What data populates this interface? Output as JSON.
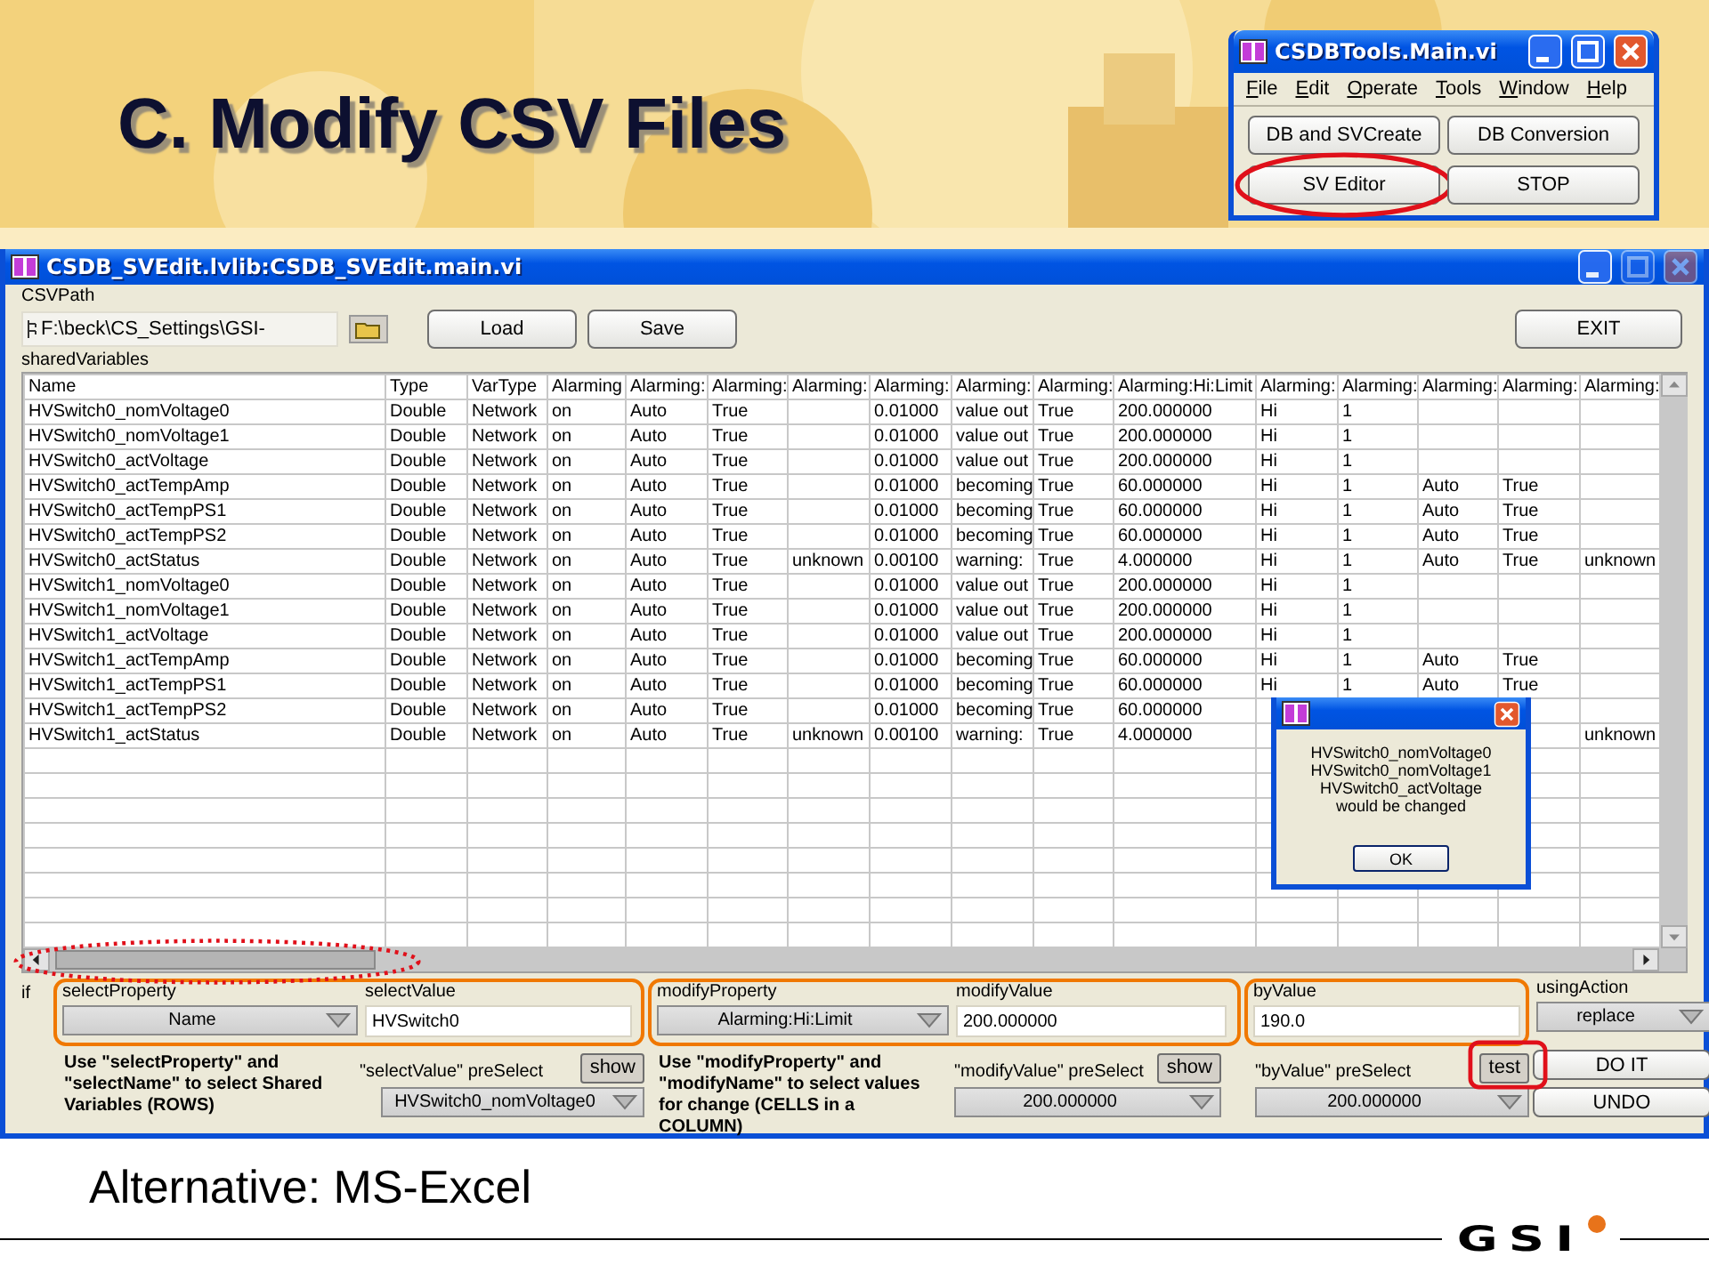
{
  "slide": {
    "title": "C. Modify CSV Files",
    "footer": "Alternative: MS-Excel",
    "logo": "GSI"
  },
  "tools_window": {
    "title": "CSDBTools.Main.vi",
    "menu": [
      "File",
      "Edit",
      "Operate",
      "Tools",
      "Window",
      "Help"
    ],
    "buttons": [
      {
        "label": "DB and SVCreate",
        "circled": false
      },
      {
        "label": "DB Conversion",
        "circled": false
      },
      {
        "label": "SV Editor",
        "circled": true
      },
      {
        "label": "STOP",
        "circled": false
      }
    ]
  },
  "editor_window": {
    "title": "CSDB_SVEdit.lvlib:CSDB_SVEdit.main.vi",
    "path_label": "CSVPath",
    "path": "F:\\beck\\CS_Settings\\GSI-",
    "buttons": [
      "Load",
      "Save"
    ],
    "exit": "EXIT",
    "table_label": "sharedVariables",
    "scrollbar_circled": true,
    "columns": [
      "Name",
      "Type",
      "VarType",
      "Alarming",
      "Alarming:",
      "Alarming:",
      "Alarming:",
      "Alarming:",
      "Alarming:",
      "Alarming:",
      "Alarming:Hi:Limit",
      "Alarming:",
      "Alarming:",
      "Alarming:",
      "Alarming:",
      "Alarming:"
    ],
    "rows": [
      [
        "HVSwitch0_nomVoltage0",
        "Double",
        "Network",
        "on",
        "Auto",
        "True",
        "",
        "0.01000",
        "value out",
        "True",
        "200.000000",
        "Hi",
        "1",
        "",
        "",
        ""
      ],
      [
        "HVSwitch0_nomVoltage1",
        "Double",
        "Network",
        "on",
        "Auto",
        "True",
        "",
        "0.01000",
        "value out",
        "True",
        "200.000000",
        "Hi",
        "1",
        "",
        "",
        ""
      ],
      [
        "HVSwitch0_actVoltage",
        "Double",
        "Network",
        "on",
        "Auto",
        "True",
        "",
        "0.01000",
        "value out",
        "True",
        "200.000000",
        "Hi",
        "1",
        "",
        "",
        ""
      ],
      [
        "HVSwitch0_actTempAmp",
        "Double",
        "Network",
        "on",
        "Auto",
        "True",
        "",
        "0.01000",
        "becoming",
        "True",
        "60.000000",
        "Hi",
        "1",
        "Auto",
        "True",
        ""
      ],
      [
        "HVSwitch0_actTempPS1",
        "Double",
        "Network",
        "on",
        "Auto",
        "True",
        "",
        "0.01000",
        "becoming",
        "True",
        "60.000000",
        "Hi",
        "1",
        "Auto",
        "True",
        ""
      ],
      [
        "HVSwitch0_actTempPS2",
        "Double",
        "Network",
        "on",
        "Auto",
        "True",
        "",
        "0.01000",
        "becoming",
        "True",
        "60.000000",
        "Hi",
        "1",
        "Auto",
        "True",
        ""
      ],
      [
        "HVSwitch0_actStatus",
        "Double",
        "Network",
        "on",
        "Auto",
        "True",
        "unknown",
        "0.00100",
        "warning:",
        "True",
        "4.000000",
        "Hi",
        "1",
        "Auto",
        "True",
        "unknown"
      ],
      [
        "HVSwitch1_nomVoltage0",
        "Double",
        "Network",
        "on",
        "Auto",
        "True",
        "",
        "0.01000",
        "value out",
        "True",
        "200.000000",
        "Hi",
        "1",
        "",
        "",
        ""
      ],
      [
        "HVSwitch1_nomVoltage1",
        "Double",
        "Network",
        "on",
        "Auto",
        "True",
        "",
        "0.01000",
        "value out",
        "True",
        "200.000000",
        "Hi",
        "1",
        "",
        "",
        ""
      ],
      [
        "HVSwitch1_actVoltage",
        "Double",
        "Network",
        "on",
        "Auto",
        "True",
        "",
        "0.01000",
        "value out",
        "True",
        "200.000000",
        "Hi",
        "1",
        "",
        "",
        ""
      ],
      [
        "HVSwitch1_actTempAmp",
        "Double",
        "Network",
        "on",
        "Auto",
        "True",
        "",
        "0.01000",
        "becoming",
        "True",
        "60.000000",
        "Hi",
        "1",
        "Auto",
        "True",
        ""
      ],
      [
        "HVSwitch1_actTempPS1",
        "Double",
        "Network",
        "on",
        "Auto",
        "True",
        "",
        "0.01000",
        "becoming",
        "True",
        "60.000000",
        "Hi",
        "1",
        "Auto",
        "True",
        ""
      ],
      [
        "HVSwitch1_actTempPS2",
        "Double",
        "Network",
        "on",
        "Auto",
        "True",
        "",
        "0.01000",
        "becoming",
        "True",
        "60.000000",
        "",
        "",
        "",
        "",
        ""
      ],
      [
        "HVSwitch1_actStatus",
        "Double",
        "Network",
        "on",
        "Auto",
        "True",
        "unknown",
        "0.00100",
        "warning:",
        "True",
        "4.000000",
        "",
        "",
        "",
        "",
        "unknown"
      ]
    ],
    "dialog": {
      "lines": [
        "HVSwitch0_nomVoltage0",
        "HVSwitch0_nomVoltage1",
        "HVSwitch0_actVoltage",
        "would be changed"
      ],
      "button": "OK"
    },
    "controls": {
      "if_label": "if",
      "select_property": {
        "label": "selectProperty",
        "value": "Name"
      },
      "select_value": {
        "label": "selectValue",
        "value": "HVSwitch0"
      },
      "modify_property": {
        "label": "modifyProperty",
        "value": "Alarming:Hi:Limit"
      },
      "modify_value": {
        "label": "modifyValue",
        "value": "200.000000"
      },
      "by_value": {
        "label": "byValue",
        "value": "190.0"
      },
      "using_action": {
        "label": "usingAction",
        "value": "replace"
      },
      "select_hint": "Use \"selectProperty\" and \"selectName\" to select Shared Variables (ROWS)",
      "select_preselect": {
        "label": "\"selectValue\" preSelect",
        "button": "show",
        "button_circled": false,
        "value": "HVSwitch0_nomVoltage0"
      },
      "modify_hint": "Use \"modifyProperty\" and \"modifyName\" to select values for change (CELLS in a COLUMN)",
      "modify_preselect": {
        "label": "\"modifyValue\" preSelect",
        "button": "show",
        "button_circled": false,
        "value": "200.000000"
      },
      "by_preselect": {
        "label": "\"byValue\" preSelect",
        "button": "test",
        "button_circled": true,
        "value": "200.000000"
      },
      "actions": [
        "DO IT",
        "UNDO"
      ]
    }
  }
}
